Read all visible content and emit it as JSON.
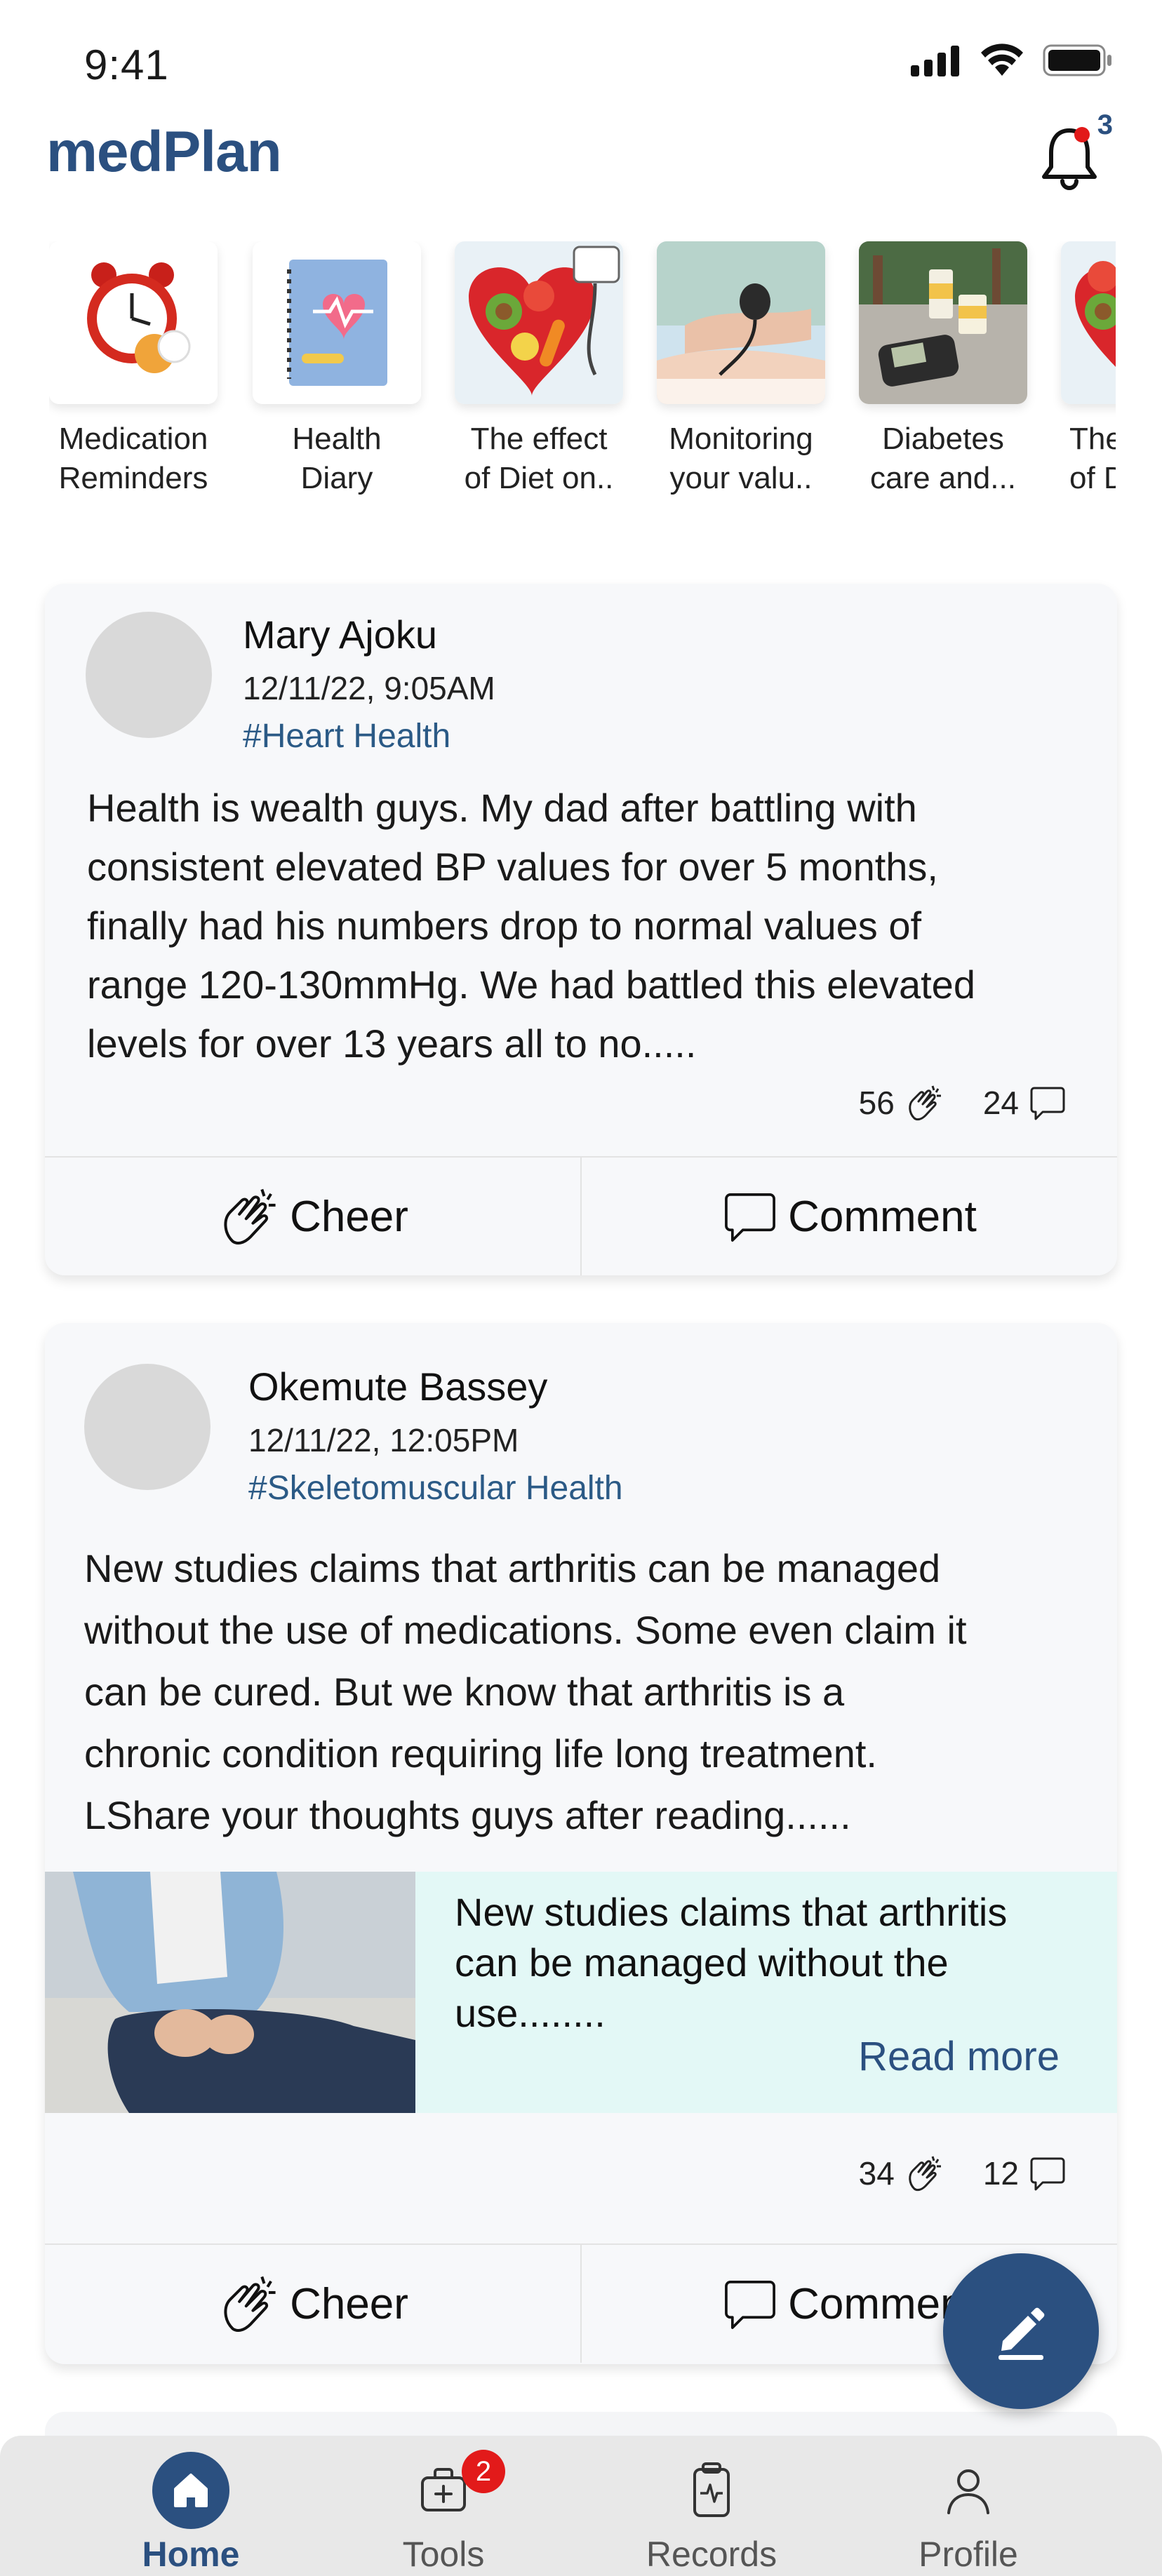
{
  "status_bar": {
    "time": "9:41"
  },
  "header": {
    "logo": "medPlan",
    "notification_count": "3"
  },
  "stories": [
    {
      "label_line1": "Medication",
      "label_line2": "Reminders",
      "icon": "alarm-clock-pills"
    },
    {
      "label_line1": "Health",
      "label_line2": "Diary",
      "icon": "diary-book"
    },
    {
      "label_line1": "The effect",
      "label_line2": "of Diet on..",
      "icon": "food-heart-stethoscope"
    },
    {
      "label_line1": "Monitoring",
      "label_line2": "your valu..",
      "icon": "blood-pressure"
    },
    {
      "label_line1": "Diabetes",
      "label_line2": "care and...",
      "icon": "glucose-meter"
    },
    {
      "label_line1": "The",
      "label_line2": "of D",
      "icon": "food-heart-stethoscope"
    }
  ],
  "posts": [
    {
      "author": "Mary Ajoku",
      "date": "12/11/22,  9:05AM",
      "tag": "#Heart Health",
      "text_lines": [
        "Health is wealth guys. My dad after battling with",
        "consistent elevated BP values for over 5 months,",
        "finally had his numbers drop to normal values of",
        "range 120-130mmHg. We had battled this elevated",
        "levels for over 13 years all to no....."
      ],
      "cheers": "56",
      "comments": "24",
      "cheer_label": "Cheer",
      "comment_label": "Comment"
    },
    {
      "author": "Okemute Bassey",
      "date": "12/11/22,  12:05PM",
      "tag": "#Skeletomuscular Health",
      "text_lines": [
        "New studies claims that arthritis can be managed",
        "without the use of medications. Some even claim it",
        "can be cured. But we know that arthritis is a",
        "chronic condition requiring life long treatment.",
        "LShare your thoughts guys after reading......"
      ],
      "preview_lines": [
        "New studies claims that arthritis",
        "can be managed without the",
        "use........"
      ],
      "read_more": "Read more",
      "cheers": "34",
      "comments": "12",
      "cheer_label": "Cheer",
      "comment_label": "Comment"
    }
  ],
  "bottom_nav": {
    "items": [
      {
        "label": "Home",
        "active": true
      },
      {
        "label": "Tools",
        "badge": "2"
      },
      {
        "label": "Records"
      },
      {
        "label": "Profile"
      }
    ]
  },
  "colors": {
    "brand": "#2b5080",
    "tag": "#2b5a86",
    "badge": "#e21a1a",
    "preview_bg": "#e3f8f6"
  }
}
